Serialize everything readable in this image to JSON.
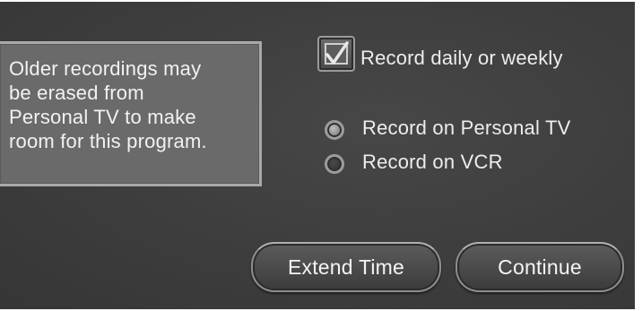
{
  "info_panel": {
    "lines": [
      "Older recordings may",
      "be erased from",
      "Personal TV to make",
      "room for this program."
    ]
  },
  "options": {
    "record_daily_weekly": {
      "label": "Record daily or weekly",
      "checked": true
    },
    "record_personal_tv": {
      "label": "Record on Personal TV",
      "selected": true
    },
    "record_vcr": {
      "label": "Record on VCR",
      "selected": false
    }
  },
  "buttons": {
    "extend_time": "Extend Time",
    "continue": "Continue"
  }
}
